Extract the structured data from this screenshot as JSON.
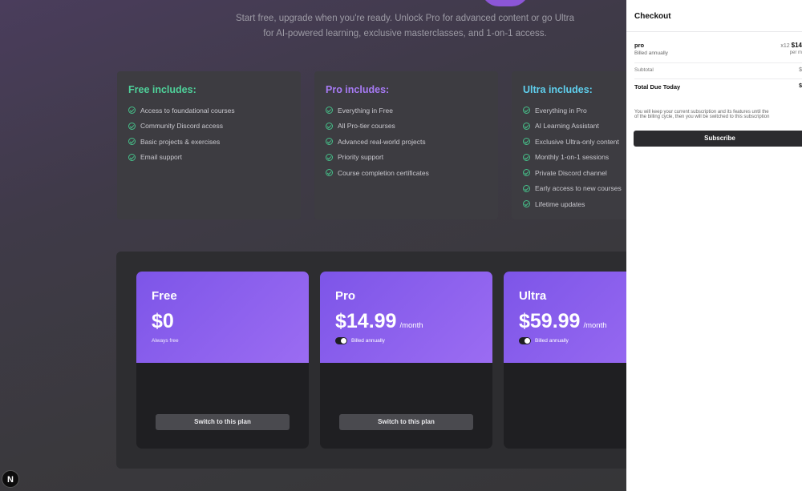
{
  "subtitle": {
    "line1": "Start free, upgrade when you're ready. Unlock Pro for advanced content or go Ultra",
    "line2": "for AI-powered learning, exclusive masterclasses, and 1-on-1 access."
  },
  "features": [
    {
      "title": "Free includes:",
      "color": "#4fd19a",
      "items": [
        "Access to foundational courses",
        "Community Discord access",
        "Basic projects & exercises",
        "Email support"
      ]
    },
    {
      "title": "Pro includes:",
      "color": "#a77bf5",
      "items": [
        "Everything in Free",
        "All Pro-tier courses",
        "Advanced real-world projects",
        "Priority support",
        "Course completion certificates"
      ]
    },
    {
      "title": "Ultra includes:",
      "color": "#5fd0ee",
      "items": [
        "Everything in Pro",
        "AI Learning Assistant",
        "Exclusive Ultra-only content",
        "Monthly 1-on-1 sessions",
        "Private Discord channel",
        "Early access to new courses",
        "Lifetime updates"
      ]
    }
  ],
  "plans": [
    {
      "name": "Free",
      "price": "$0",
      "per": "",
      "note": "Always free",
      "button": "Switch to this plan"
    },
    {
      "name": "Pro",
      "price": "$14.99",
      "per": "/month",
      "toggle_label": "Billed annually",
      "button": "Switch to this plan"
    },
    {
      "name": "Ultra",
      "price": "$59.99",
      "per": "/month",
      "toggle_label": "Billed annually",
      "button": ""
    }
  ],
  "checkout": {
    "title": "Checkout",
    "item_name": "pro",
    "item_billing": "Billed annually",
    "item_price_prefix": "x12",
    "item_price": "$14",
    "item_per": "per m",
    "subtotal_label": "Subtotal",
    "subtotal_value": "$",
    "total_label": "Total Due Today",
    "total_value": "$",
    "notice_line1": "You will keep your current subscription and its features until the",
    "notice_line2": "of the billing cycle, then you will be switched to this subscription",
    "subscribe_label": "Subscribe"
  },
  "next_badge": "N"
}
